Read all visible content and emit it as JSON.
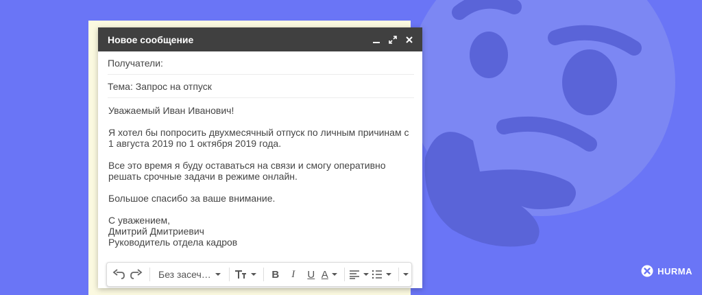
{
  "compose": {
    "title": "Новое сообщение",
    "recipients_label": "Получатели:",
    "subject": "Тема: Запрос на отпуск",
    "greeting": "Уважаемый Иван Иванович!",
    "paragraph1_line1": "Я хотел бы попросить двухмесячный отпуск по личным причинам с",
    "paragraph1_line2": "1 августа 2019 по 1 октября 2019 года.",
    "paragraph2_line1": "Все это время я буду оставаться на связи и смогу оперативно",
    "paragraph2_line2": "решать срочные задачи в режиме онлайн.",
    "paragraph3": "Большое спасибо за ваше внимание.",
    "signature": {
      "closing": "С уважением,",
      "name": "Дмитрий Дмитриевич",
      "position": "Руководитель отдела кадров"
    }
  },
  "toolbar": {
    "font_select": "Без засеч…",
    "bold": "B",
    "italic": "I",
    "underline": "U",
    "text_color": "A"
  },
  "brand": {
    "name": "HURMA"
  },
  "colors": {
    "background": "#6a75f6",
    "header": "#404040",
    "emoji": "#7c87f3",
    "emoji_features": "#5a64d8"
  },
  "icons": [
    "minimize-icon",
    "expand-icon",
    "close-icon",
    "undo-icon",
    "redo-icon",
    "text-size-icon",
    "align-icon",
    "numbered-list-icon",
    "more-icon",
    "hurma-logo-icon"
  ]
}
